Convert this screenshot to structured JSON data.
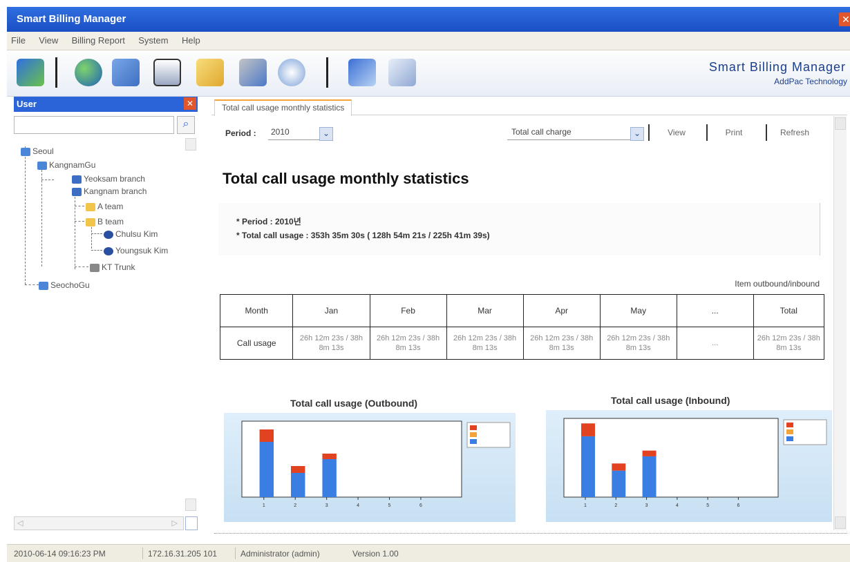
{
  "window": {
    "title": "Smart Billing Manager"
  },
  "menu": [
    "File",
    "View",
    "Billing Report",
    "System",
    "Help"
  ],
  "toolbar": {
    "icons": [
      "network-icon",
      "globe-icon",
      "users-network-icon",
      "printer-icon",
      "folder-open-icon",
      "users-icon",
      "badge-clock-icon",
      "edit-icon",
      "settings-icon"
    ],
    "brand": "Smart Billing Manager",
    "company": "AddPac Technology"
  },
  "left_panel": {
    "title": "User",
    "search_value": "",
    "tree": [
      "Seoul",
      "KangnamGu",
      "Yeoksam branch",
      "Kangnam branch",
      "A team",
      "B team",
      "Chulsu Kim",
      "Youngsuk Kim",
      "KT Trunk",
      "SeochoGu"
    ]
  },
  "tabs": [
    "Total call usage monthly statistics"
  ],
  "controls": {
    "period_label": "Period :",
    "period_value": "2010",
    "metric_value": "Total call charge",
    "view": "View",
    "print": "Print",
    "refresh": "Refresh"
  },
  "report": {
    "title": "Total call usage monthly statistics",
    "period_line": "* Period : 2010년",
    "usage_line": "* Total call usage : 353h 35m 30s ( 128h 54m 21s / 225h 41m 39s)",
    "note": "Item outbound/inbound",
    "table": {
      "headers": [
        "Month",
        "Jan",
        "Feb",
        "Mar",
        "Apr",
        "May",
        "...",
        "Total"
      ],
      "row_label": "Call usage",
      "cells": [
        "26h 12m 23s / 38h 8m 13s",
        "26h 12m 23s / 38h 8m 13s",
        "26h 12m 23s / 38h 8m 13s",
        "26h 12m 23s / 38h 8m 13s",
        "26h 12m 23s / 38h 8m 13s",
        "...",
        "26h 12m 23s / 38h 8m 13s"
      ]
    }
  },
  "chart_data": [
    {
      "type": "bar",
      "title": "Total call usage (Outbound)",
      "categories": [
        "1",
        "2",
        "3",
        "4",
        "5",
        "6"
      ],
      "series": [
        {
          "values": [
            80,
            35,
            55,
            0,
            0,
            0
          ]
        },
        {
          "values": [
            0,
            0,
            0,
            0,
            0,
            0
          ]
        },
        {
          "values": [
            18,
            10,
            8,
            0,
            0,
            0
          ]
        }
      ],
      "ylim": [
        0,
        110
      ],
      "colors": [
        "#3a7ee4",
        "#f2a33a",
        "#e1421f"
      ],
      "legend": "top-right",
      "grid": false
    },
    {
      "type": "bar",
      "title": "Total call usage (Inbound)",
      "categories": [
        "1",
        "2",
        "3",
        "4",
        "5",
        "6"
      ],
      "series": [
        {
          "values": [
            85,
            37,
            57,
            0,
            0,
            0
          ]
        },
        {
          "values": [
            0,
            0,
            0,
            0,
            0,
            0
          ]
        },
        {
          "values": [
            18,
            10,
            8,
            0,
            0,
            0
          ]
        }
      ],
      "ylim": [
        0,
        110
      ],
      "colors": [
        "#3a7ee4",
        "#f2a33a",
        "#e1421f"
      ],
      "legend": "top-right",
      "grid": false
    }
  ],
  "status": {
    "datetime": "2010-06-14 09:16:23 PM",
    "ip": "172.16.31.205 101",
    "user": "Administrator (admin)",
    "version": "Version 1.00"
  }
}
